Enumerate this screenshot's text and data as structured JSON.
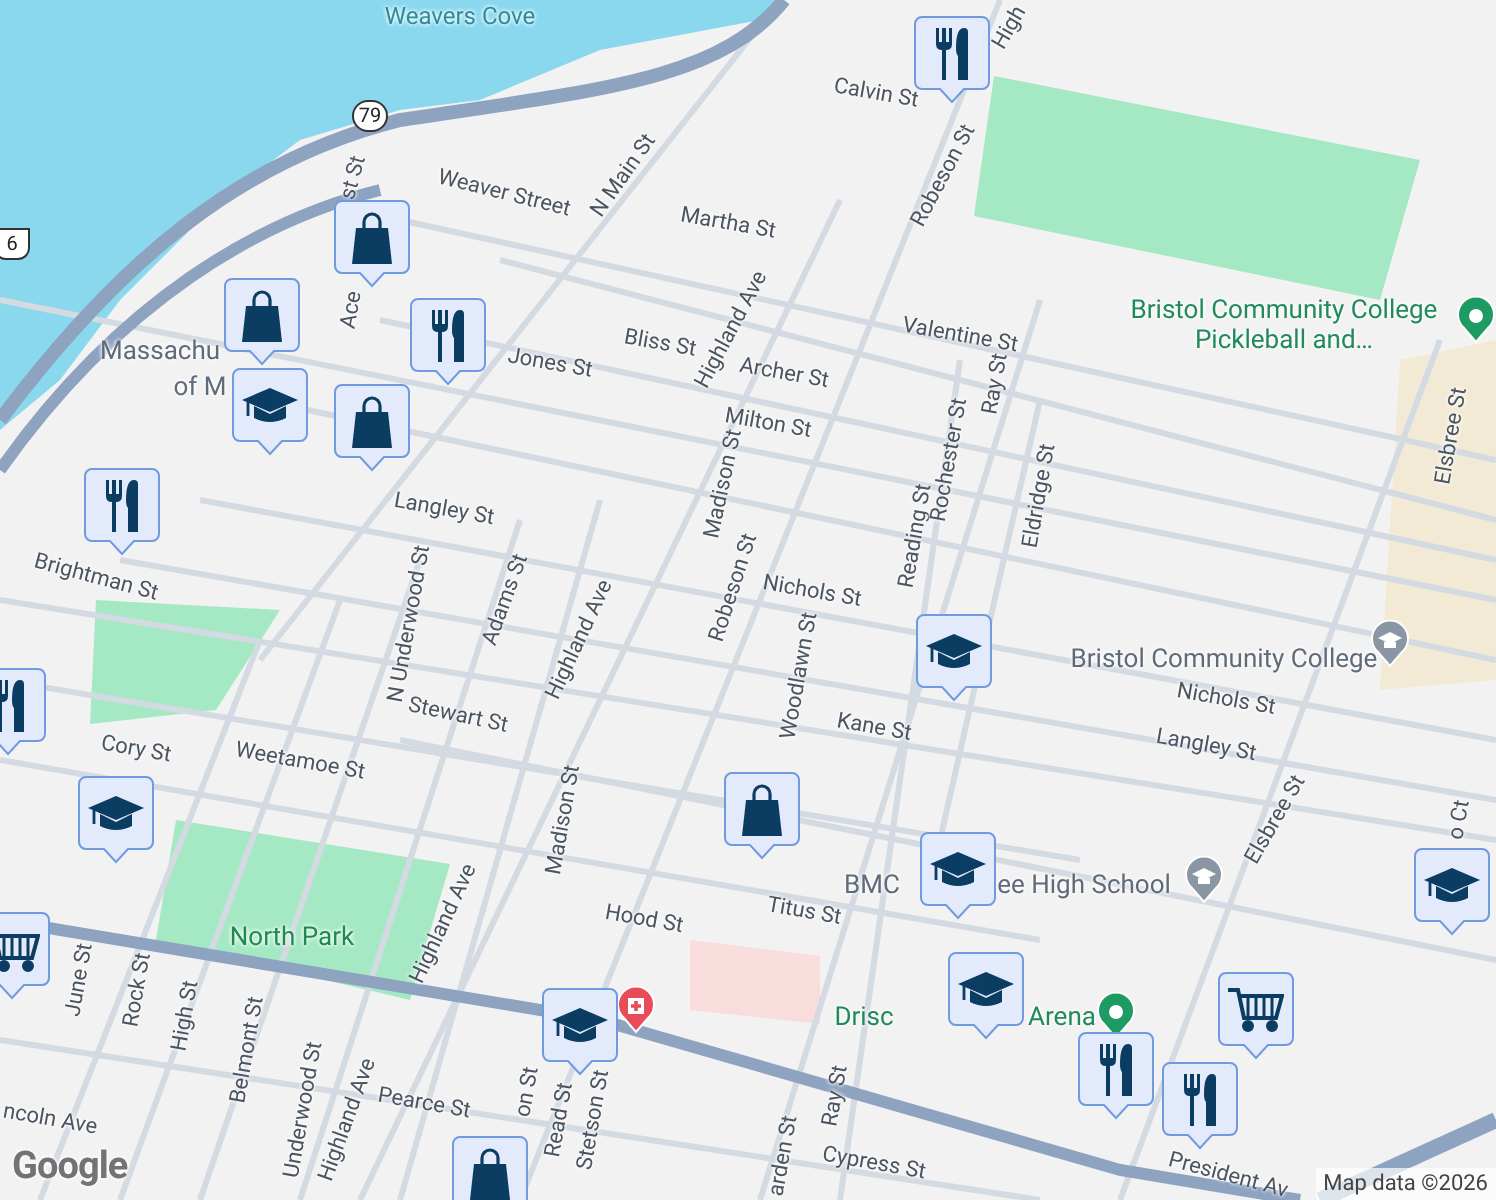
{
  "map": {
    "labels": [
      {
        "kind": "water",
        "text": "Weavers Cove"
      },
      {
        "kind": "street",
        "text": "Weaver Street"
      },
      {
        "kind": "street",
        "text": "N Main St"
      },
      {
        "kind": "street",
        "text": "Martha St"
      },
      {
        "kind": "street",
        "text": "Calvin St"
      },
      {
        "kind": "street",
        "text": "High"
      },
      {
        "kind": "street",
        "text": "Robeson St"
      },
      {
        "kind": "street",
        "text": "Valentine St"
      },
      {
        "kind": "street",
        "text": "Bliss St"
      },
      {
        "kind": "street",
        "text": "Archer St"
      },
      {
        "kind": "street",
        "text": "Jones St"
      },
      {
        "kind": "street",
        "text": "Highland Ave"
      },
      {
        "kind": "street",
        "text": "Milton St"
      },
      {
        "kind": "street",
        "text": "Madison St"
      },
      {
        "kind": "street",
        "text": "Langley St"
      },
      {
        "kind": "street",
        "text": "Brightman St"
      },
      {
        "kind": "street",
        "text": "st St"
      },
      {
        "kind": "street",
        "text": "Ace"
      },
      {
        "kind": "street",
        "text": "Reading St"
      },
      {
        "kind": "street",
        "text": "Rochester St"
      },
      {
        "kind": "street",
        "text": "Ray St"
      },
      {
        "kind": "street",
        "text": "Eldridge St"
      },
      {
        "kind": "street",
        "text": "Robeson St"
      },
      {
        "kind": "street",
        "text": "Nichols St"
      },
      {
        "kind": "street",
        "text": "Woodlawn St"
      },
      {
        "kind": "street",
        "text": "Adams St"
      },
      {
        "kind": "street",
        "text": "Highland Ave"
      },
      {
        "kind": "street",
        "text": "N Underwood St"
      },
      {
        "kind": "street",
        "text": "Stewart St"
      },
      {
        "kind": "street",
        "text": "Cory St"
      },
      {
        "kind": "street",
        "text": "Weetamoe St"
      },
      {
        "kind": "street",
        "text": "Madison St"
      },
      {
        "kind": "street",
        "text": "Kane St"
      },
      {
        "kind": "street",
        "text": "Nichols St"
      },
      {
        "kind": "street",
        "text": "Langley St"
      },
      {
        "kind": "landmark",
        "text": "Bristol Community College Pickleball and…"
      },
      {
        "kind": "poi",
        "text": "Bristol Community College"
      },
      {
        "kind": "street",
        "text": "Elsbree St"
      },
      {
        "kind": "street",
        "text": "Elsbree St"
      },
      {
        "kind": "street",
        "text": "Hood St"
      },
      {
        "kind": "street",
        "text": "Titus St"
      },
      {
        "kind": "park",
        "text": "North Park"
      },
      {
        "kind": "street",
        "text": "Highland Ave"
      },
      {
        "kind": "street",
        "text": "Highland Ave"
      },
      {
        "kind": "street",
        "text": "June St"
      },
      {
        "kind": "street",
        "text": "Rock St"
      },
      {
        "kind": "street",
        "text": "High St"
      },
      {
        "kind": "street",
        "text": "Belmont St"
      },
      {
        "kind": "street",
        "text": "Underwood St"
      },
      {
        "kind": "street",
        "text": "Pearce St"
      },
      {
        "kind": "street",
        "text": "ncoln Ave"
      },
      {
        "kind": "street",
        "text": "Read St"
      },
      {
        "kind": "street",
        "text": "Stetson St"
      },
      {
        "kind": "street",
        "text": "on St"
      },
      {
        "kind": "street",
        "text": "Ray St"
      },
      {
        "kind": "street",
        "text": "arden St"
      },
      {
        "kind": "street",
        "text": "Cypress St"
      },
      {
        "kind": "street",
        "text": "President Av"
      },
      {
        "kind": "poi",
        "text": "Massachu"
      },
      {
        "kind": "poi",
        "text": "of M"
      },
      {
        "kind": "poi",
        "text": "BMC"
      },
      {
        "kind": "poi",
        "text": "ee High School"
      },
      {
        "kind": "landmark",
        "text": "Drisc"
      },
      {
        "kind": "landmark",
        "text": "Arena"
      },
      {
        "kind": "street",
        "text": "o Ct"
      }
    ],
    "shields": [
      {
        "kind": "state",
        "text": "79"
      },
      {
        "kind": "us",
        "text": "6"
      }
    ],
    "pins": [
      {
        "kind": "landmark"
      },
      {
        "kind": "landmark"
      },
      {
        "kind": "school"
      },
      {
        "kind": "school"
      },
      {
        "kind": "hospital"
      }
    ],
    "markers": [
      {
        "kind": "restaurant"
      },
      {
        "kind": "shopping"
      },
      {
        "kind": "shopping"
      },
      {
        "kind": "school"
      },
      {
        "kind": "restaurant"
      },
      {
        "kind": "shopping"
      },
      {
        "kind": "restaurant"
      },
      {
        "kind": "school"
      },
      {
        "kind": "shopping"
      },
      {
        "kind": "school"
      },
      {
        "kind": "school"
      },
      {
        "kind": "grocery"
      },
      {
        "kind": "restaurant"
      },
      {
        "kind": "restaurant"
      },
      {
        "kind": "school"
      },
      {
        "kind": "school"
      },
      {
        "kind": "restaurant"
      },
      {
        "kind": "school"
      },
      {
        "kind": "grocery"
      },
      {
        "kind": "shopping"
      }
    ]
  },
  "logo": "Google",
  "attribution": "Map data ©2026"
}
